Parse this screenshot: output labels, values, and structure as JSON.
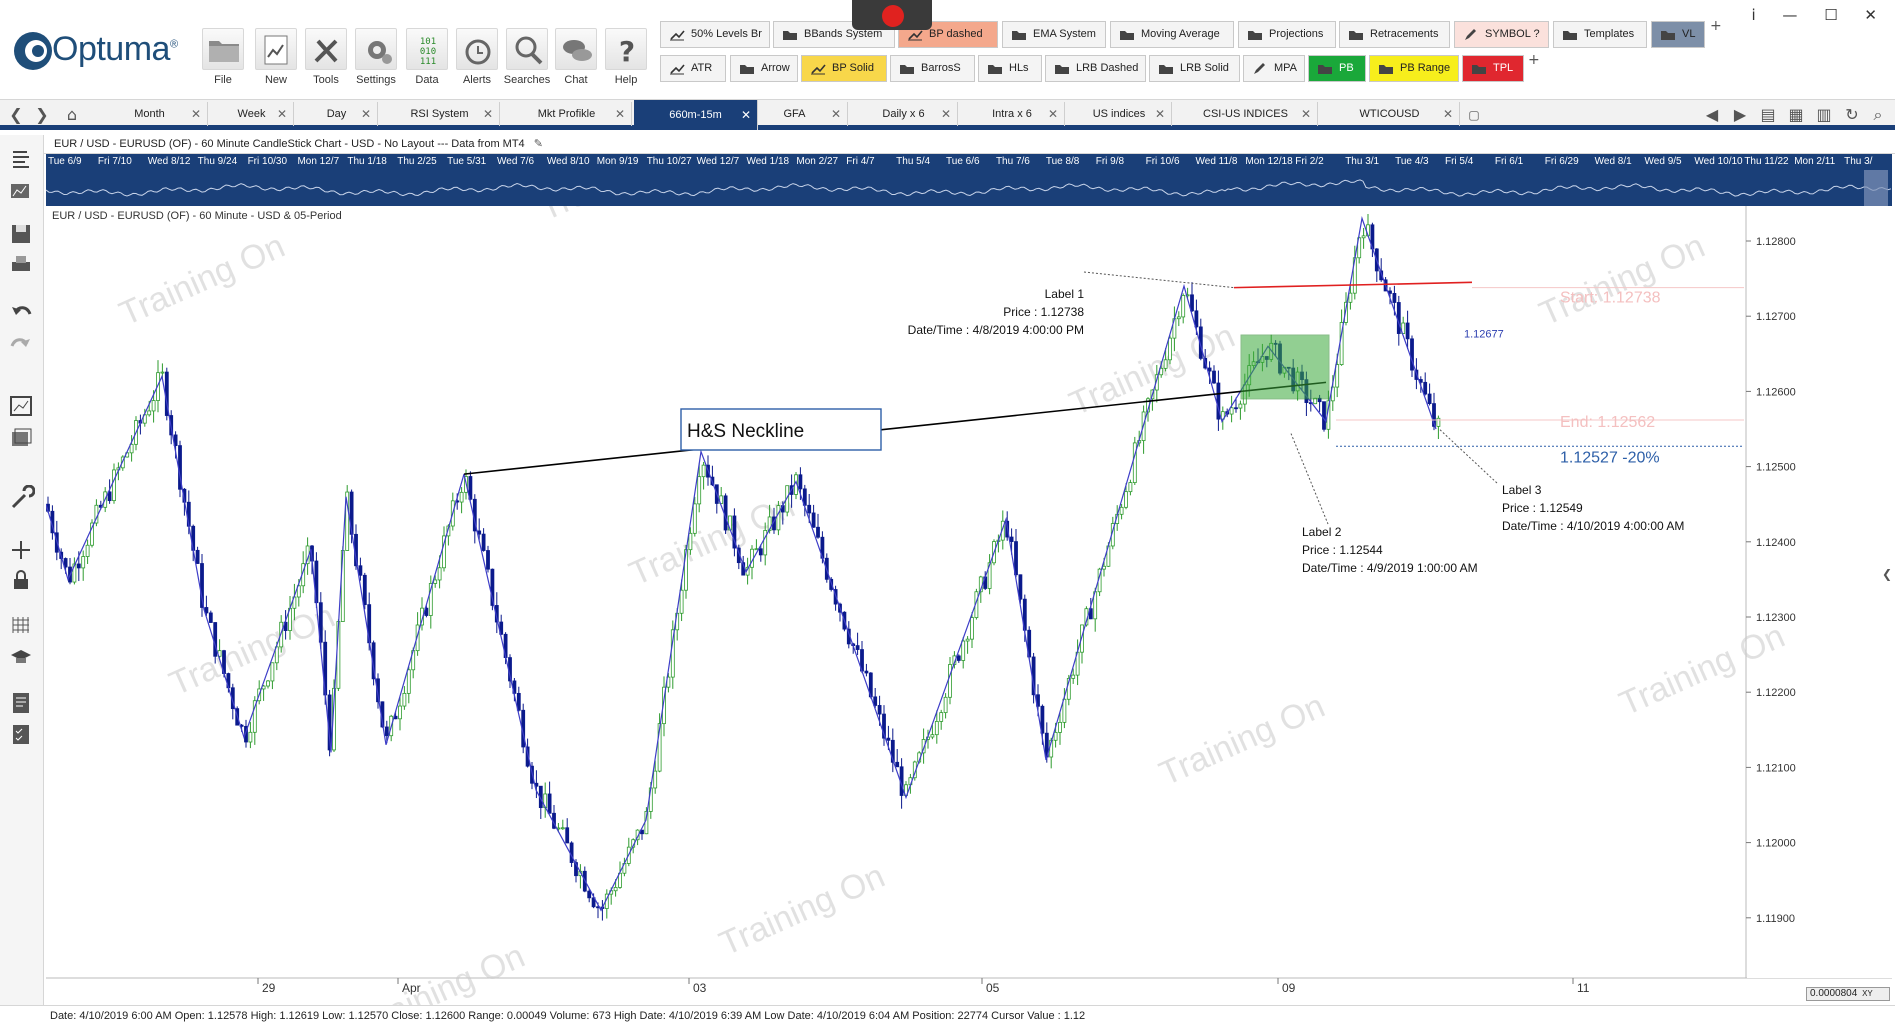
{
  "app": {
    "name": "Optuma",
    "trademark": "®",
    "window_controls": [
      "i",
      "—",
      "☐",
      "✕"
    ]
  },
  "ribbon": {
    "buttons": [
      {
        "label": "File",
        "icon": "folder-icon"
      },
      {
        "label": "New",
        "icon": "new-chart-icon"
      },
      {
        "label": "Tools",
        "icon": "tools-icon"
      },
      {
        "label": "Settings",
        "icon": "gear-icon"
      },
      {
        "label": "Data",
        "icon": "binary-data-icon"
      },
      {
        "label": "Alerts",
        "icon": "alarm-clock-icon"
      },
      {
        "label": "Searches",
        "icon": "magnifier-icon"
      },
      {
        "label": "Chat",
        "icon": "chat-bubbles-icon"
      },
      {
        "label": "Help",
        "icon": "question-icon"
      }
    ],
    "toolbar_row1": [
      {
        "label": "50% Levels Br",
        "icon": "tool-icon"
      },
      {
        "label": "BBands System",
        "icon": "folder-icon"
      },
      {
        "label": "BP dashed",
        "icon": "tool-icon",
        "color": "#f4a88c"
      },
      {
        "label": "EMA System",
        "icon": "folder-icon"
      },
      {
        "label": "Moving Average",
        "icon": "folder-icon"
      },
      {
        "label": "Projections",
        "icon": "folder-icon"
      },
      {
        "label": "Retracements",
        "icon": "folder-icon"
      },
      {
        "label": "SYMBOL ?",
        "icon": "pencil-icon",
        "color": "#fbe1dc"
      },
      {
        "label": "Templates",
        "icon": "folder-icon"
      },
      {
        "label": "VL",
        "icon": "folder-icon",
        "color": "#7d8fa8"
      }
    ],
    "toolbar_row2": [
      {
        "label": "ATR",
        "icon": "tool-icon"
      },
      {
        "label": "Arrow",
        "icon": "folder-icon"
      },
      {
        "label": "BP Solid",
        "icon": "tool-icon",
        "color": "#f8d74a"
      },
      {
        "label": "BarrosS",
        "icon": "folder-icon"
      },
      {
        "label": "HLs",
        "icon": "folder-icon"
      },
      {
        "label": "LRB Dashed",
        "icon": "folder-icon"
      },
      {
        "label": "LRB Solid",
        "icon": "folder-icon"
      },
      {
        "label": "MPA",
        "icon": "pencil-icon"
      },
      {
        "label": "PB",
        "icon": "folder-icon",
        "color": "#1aa83a"
      },
      {
        "label": "PB Range",
        "icon": "folder-icon",
        "color": "#f7ee1c"
      },
      {
        "label": "TPL",
        "icon": "folder-icon",
        "color": "#e0272f"
      }
    ],
    "plus": "+"
  },
  "tabs": [
    {
      "label": "Month"
    },
    {
      "label": "Week"
    },
    {
      "label": "Day"
    },
    {
      "label": "RSI System"
    },
    {
      "label": "Mkt Profikle"
    },
    {
      "label": "660m-15m",
      "active": true
    },
    {
      "label": "GFA"
    },
    {
      "label": "Daily x 6"
    },
    {
      "label": "Intra x 6"
    },
    {
      "label": "US indices"
    },
    {
      "label": "CSI-US INDICES"
    },
    {
      "label": "WTICOUSD"
    }
  ],
  "tab_close": "✕",
  "chart": {
    "title": "EUR / USD - EURUSD (OF) - 60 Minute CandleStick Chart - USD - No Layout --- Data from MT4",
    "subtitle": "EUR / USD - EURUSD (OF) - 60 Minute - USD & 05-Period",
    "overview_dates": [
      "Tue 6/9",
      "Fri 7/10",
      "Wed 8/12",
      "Thu 9/24",
      "Fri 10/30",
      "Mon 12/7",
      "Thu 1/18",
      "Thu 2/25",
      "Tue 5/31",
      "Wed 7/6",
      "Wed 8/10",
      "Mon 9/19",
      "Thu 10/27",
      "Wed 12/7",
      "Wed 1/18",
      "Mon 2/27",
      "Fri 4/7",
      "Thu 5/4",
      "Tue 6/6",
      "Thu 7/6",
      "Tue 8/8",
      "Fri 9/8",
      "Fri 10/6",
      "Wed 11/8",
      "Mon 12/18",
      "Fri 2/2",
      "Thu 3/1",
      "Tue 4/3",
      "Fri 5/4",
      "Fri 6/1",
      "Fri 6/29",
      "Wed 8/1",
      "Wed 9/5",
      "Wed 10/10",
      "Thu 11/22",
      "Mon 2/11",
      "Thu 3/"
    ],
    "price_axis": [
      "1.12800",
      "1.12700",
      "1.12600",
      "1.12500",
      "1.12400",
      "1.12300",
      "1.12200",
      "1.12100",
      "1.12000",
      "1.11900"
    ],
    "date_axis": [
      "29",
      "Apr",
      "03",
      "05",
      "09",
      "11"
    ],
    "watermark": "Training On",
    "neckline_label": "H&S Neckline",
    "label1": {
      "title": "Label 1",
      "price": "Price : 1.12738",
      "datetime": "Date/Time : 4/8/2019 4:00:00 PM"
    },
    "label2": {
      "title": "Label 2",
      "price": "Price : 1.12544",
      "datetime": "Date/Time : 4/9/2019 1:00:00 AM"
    },
    "label3": {
      "title": "Label 3",
      "price": "Price : 1.12549",
      "datetime": "Date/Time : 4/10/2019 4:00:00 AM"
    },
    "projection_price": "1.12677",
    "start_label": "Start:  1.12738",
    "end_label": "End:  1.12562",
    "target_label": "1.12527    -20%",
    "corner_value": "0.0000804",
    "corner_xy": "XY"
  },
  "status": {
    "text": "Date: 4/10/2019 6:00 AM Open: 1.12578 High: 1.12619 Low: 1.12570 Close: 1.12600 Range: 0.00049 Volume: 673 High Date: 4/10/2019 6:39 AM Low Date: 4/10/2019 6:04 AM Position: 22774 Cursor Value : 1.12"
  },
  "colors": {
    "brand_blue": "#1a3f78",
    "bull_candle": "#2e9b2e",
    "bear_candle": "#0b1a8c",
    "zigzag": "#3d3dc8",
    "resistance_line": "#e02020",
    "box_fill": "#3aa83a"
  }
}
